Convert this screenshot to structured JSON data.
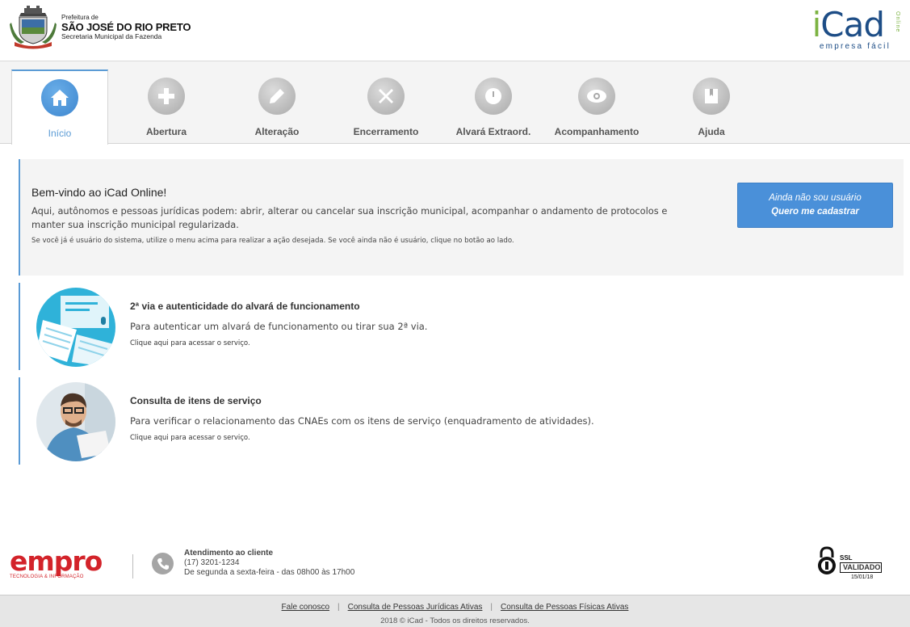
{
  "header": {
    "prefeitura_label": "Prefeitura de",
    "city": "SÃO JOSÉ DO RIO PRETO",
    "secretaria": "Secretaria Municipal da Fazenda",
    "logo": {
      "main_i": "i",
      "main_rest": "Cad",
      "tagline": "empresa fácil",
      "vertical": "Online"
    }
  },
  "nav": {
    "tabs": [
      {
        "label": "Início",
        "icon": "home-icon",
        "active": true
      },
      {
        "label": "Abertura",
        "icon": "plus-icon",
        "active": false
      },
      {
        "label": "Alteração",
        "icon": "pencil-icon",
        "active": false
      },
      {
        "label": "Encerramento",
        "icon": "close-icon",
        "active": false
      },
      {
        "label": "Alvará Extraord.",
        "icon": "clock-icon",
        "active": false
      },
      {
        "label": "Acompanhamento",
        "icon": "eye-icon",
        "active": false
      },
      {
        "label": "Ajuda",
        "icon": "book-icon",
        "active": false
      }
    ]
  },
  "welcome": {
    "title": "Bem-vindo ao iCad Online!",
    "description": "Aqui, autônomos e pessoas jurídicas podem: abrir, alterar ou cancelar sua inscrição municipal, acompanhar o andamento de protocolos e manter sua inscrição municipal regularizada.",
    "note": "Se você já é usuário do sistema, utilize o menu acima para realizar a ação desejada. Se você ainda não é usuário, clique no botão ao lado.",
    "cta_line1": "Ainda não sou usuário",
    "cta_line2": "Quero me cadastrar"
  },
  "services": [
    {
      "title": "2ª via e autenticidade do alvará de funcionamento",
      "description": "Para autenticar um alvará de funcionamento ou tirar sua 2ª via.",
      "link": "Clique aqui para acessar o serviço."
    },
    {
      "title": "Consulta de itens de serviço",
      "description": "Para verificar o relacionamento das CNAEs com os itens de serviço (enquadramento de atividades).",
      "link": "Clique aqui para acessar o serviço."
    }
  ],
  "footer": {
    "empro_word": "empro",
    "empro_sub": "TECNOLOGIA & INFORMAÇÃO",
    "contact_title": "Atendimento ao cliente",
    "phone": "(17) 3201-1234",
    "hours": "De segunda a sexta-feira - das 08h00 às 17h00",
    "ssl_label": "SSL",
    "ssl_validated": "VALIDADO",
    "ssl_date": "15/01/18",
    "links": [
      "Fale conosco",
      "Consulta de Pessoas Jurídicas Ativas",
      "Consulta de Pessoas Físicas Ativas"
    ],
    "copyright": "2018 © iCad - Todos os direitos reservados."
  },
  "colors": {
    "accent": "#5b9bd5",
    "cta": "#4a90d9",
    "icad_blue": "#1d4d86",
    "icad_green": "#7cb342",
    "empro_red": "#d3232a"
  }
}
